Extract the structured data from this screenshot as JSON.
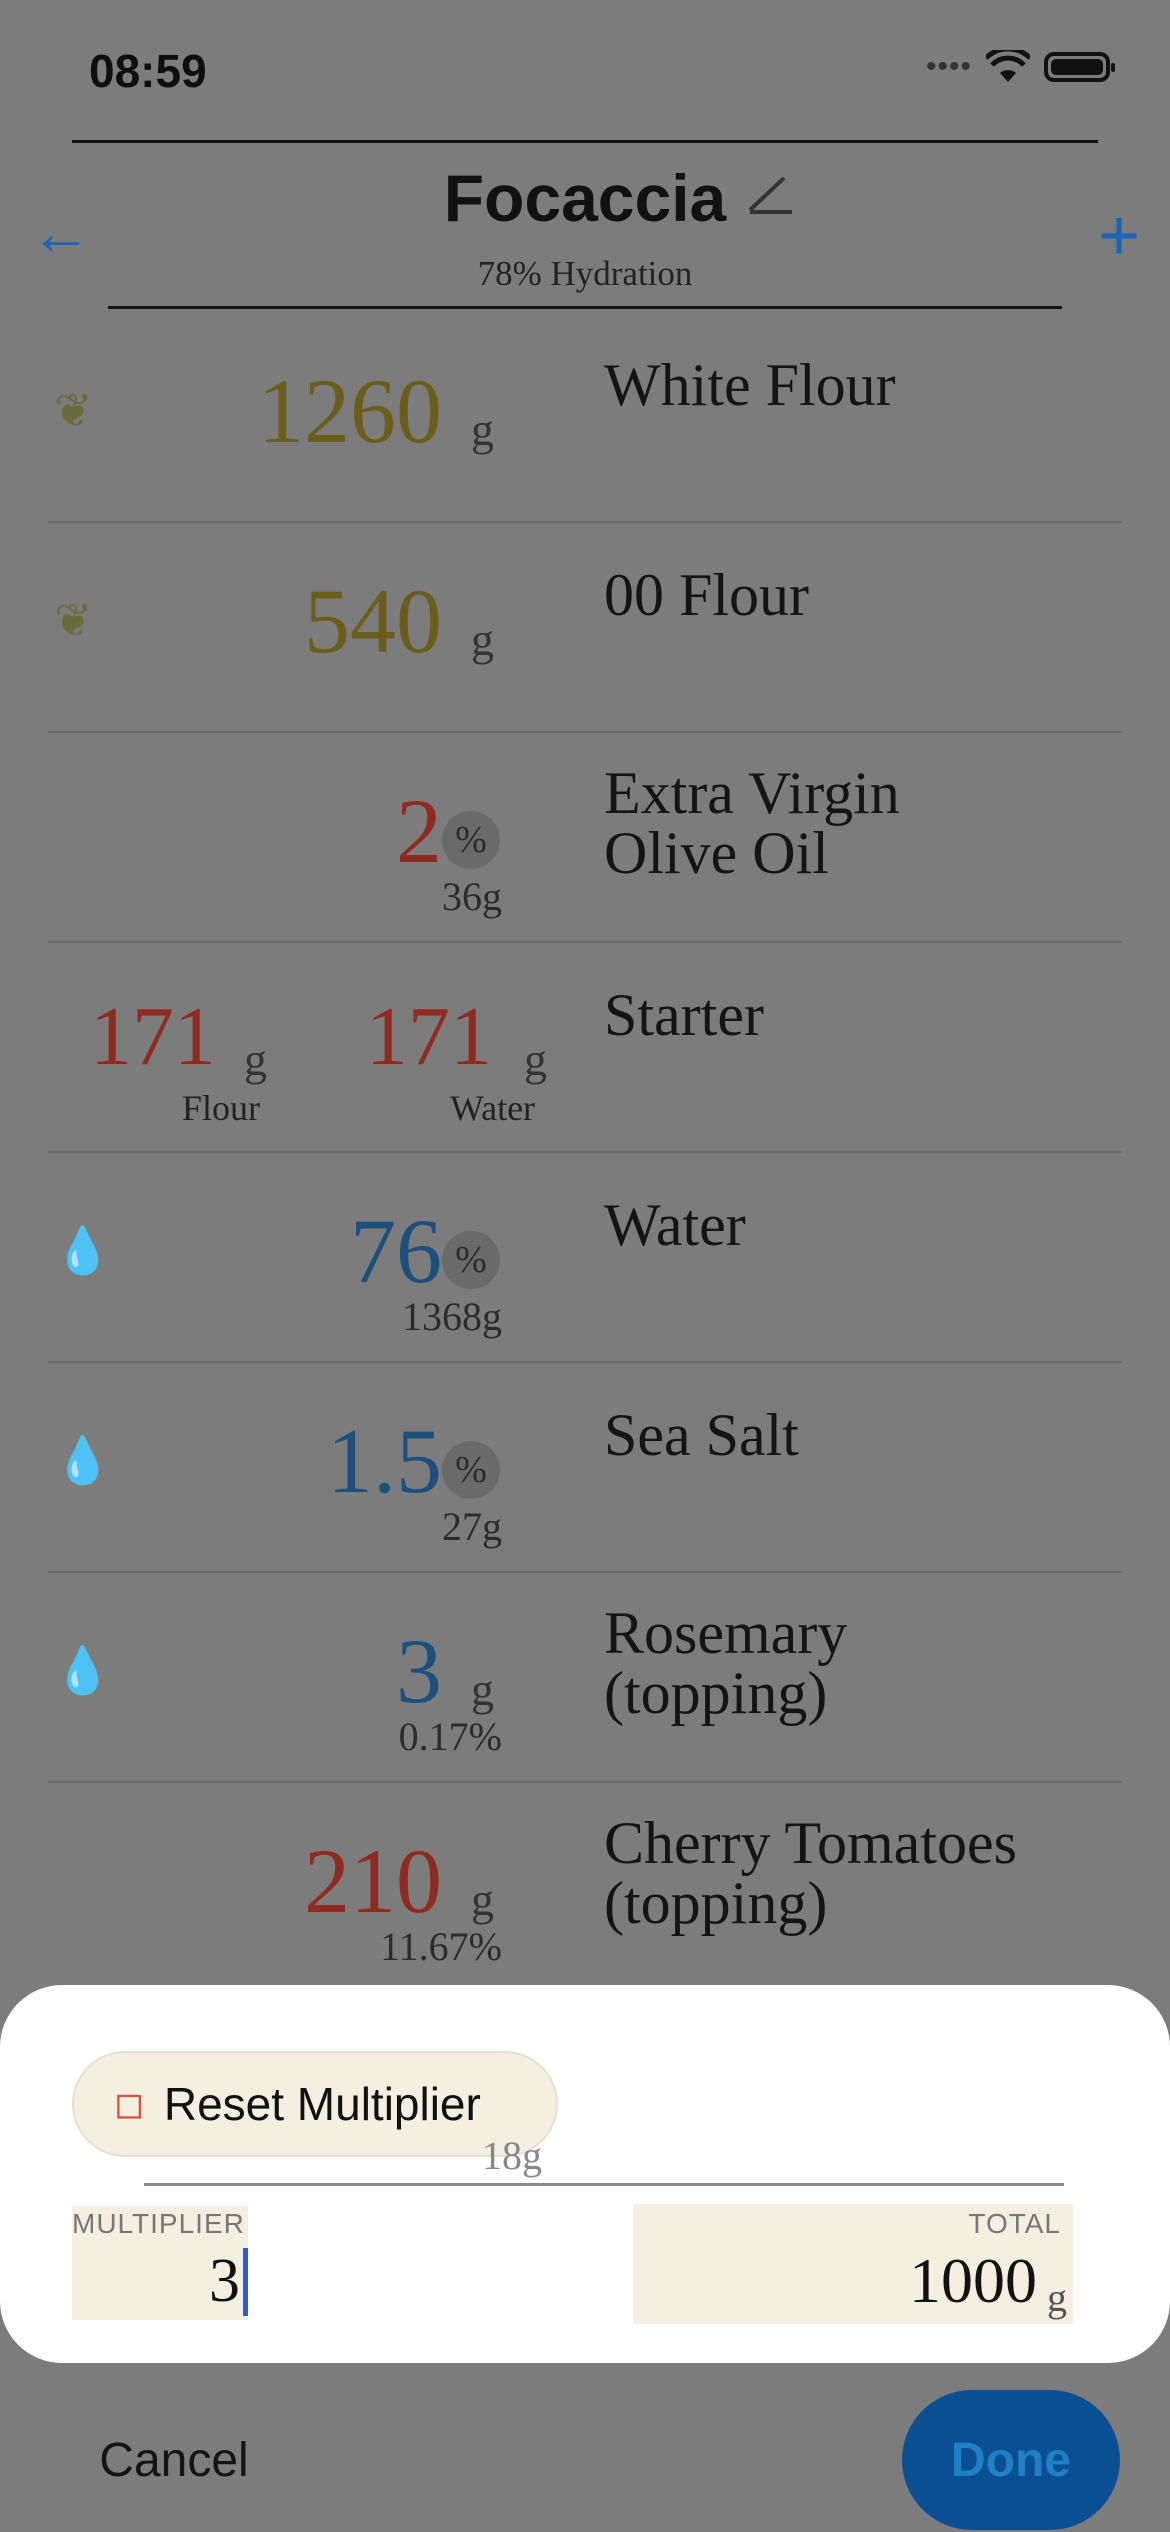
{
  "status_bar": {
    "time": "08:59"
  },
  "header": {
    "back_icon": "arrow-left-icon",
    "title": "Focaccia",
    "edit_icon": "pencil-icon",
    "subtitle": "78% Hydration",
    "add_icon": "plus-icon"
  },
  "ingredients": [
    {
      "icon": "wheat-icon",
      "amount": "1260",
      "unit": "g",
      "name": "White Flour"
    },
    {
      "icon": "wheat-icon",
      "amount": "540",
      "unit": "g",
      "name": "00 Flour"
    },
    {
      "amount": "2",
      "unit": "%",
      "sub": "36g",
      "name_line1": "Extra Virgin",
      "name_line2": "Olive Oil"
    },
    {
      "flour_amount": "171",
      "flour_unit": "g",
      "flour_label": "Flour",
      "water_amount": "171",
      "water_unit": "g",
      "water_label": "Water",
      "name": "Starter"
    },
    {
      "icon": "drop-icon",
      "amount": "76",
      "unit": "%",
      "sub": "1368g",
      "name": "Water"
    },
    {
      "icon": "drop-icon",
      "amount": "1.5",
      "unit": "%",
      "sub": "27g",
      "name": "Sea Salt"
    },
    {
      "icon": "drop-icon",
      "amount": "3",
      "unit": "g",
      "sub": "0.17%",
      "name_line1": "Rosemary",
      "name_line2": "(topping)"
    },
    {
      "amount": "210",
      "unit": "g",
      "sub": "11.67%",
      "name_line1": "Cherry Tomatoes",
      "name_line2": "(topping)"
    }
  ],
  "sheet": {
    "reset_label": "Reset Multiplier",
    "reset_icon": "eraser-icon",
    "partial_value": "18g",
    "multiplier_label": "MULTIPLIER",
    "multiplier_value": "3",
    "total_label": "TOTAL",
    "total_value": "1000",
    "total_unit": "g"
  },
  "footer": {
    "cancel_label": "Cancel",
    "done_label": "Done"
  },
  "colors": {
    "accent": "#1a64b8",
    "flour": "#6a5d1a",
    "red": "#8e2a20",
    "liquid": "#1d4f7c",
    "sheet_field": "#f5efe2"
  }
}
